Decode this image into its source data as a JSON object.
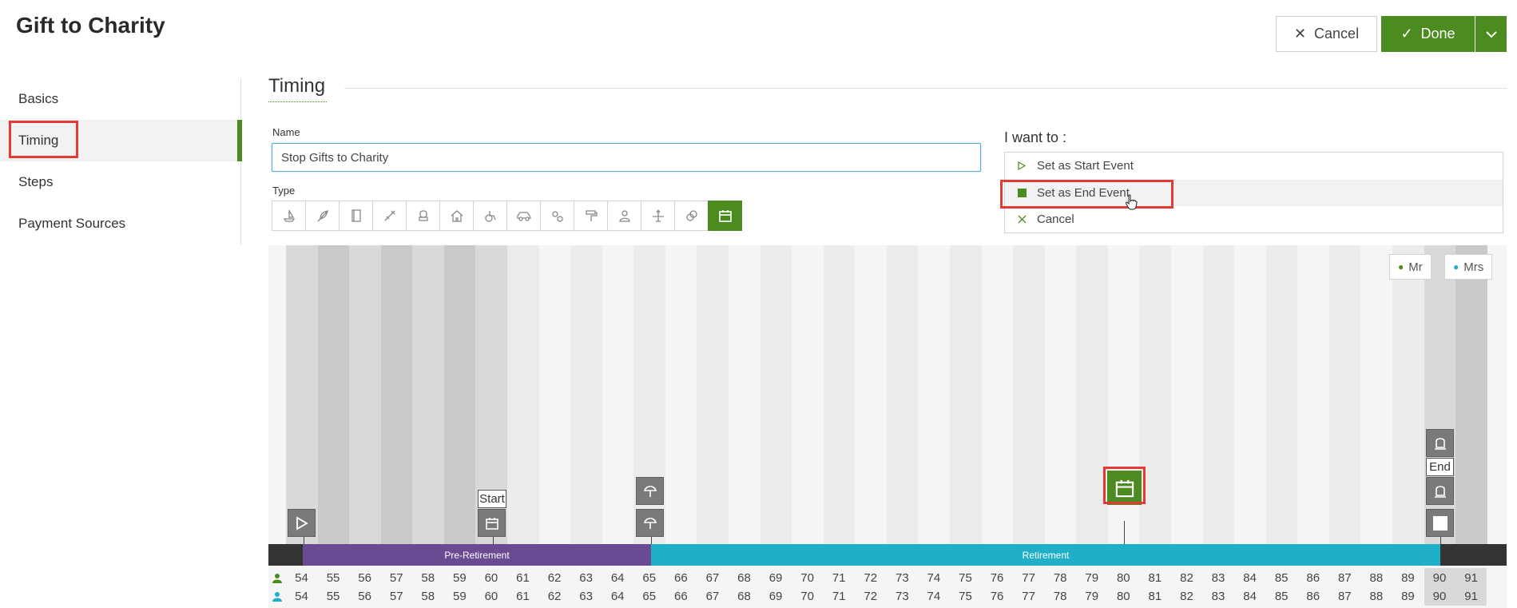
{
  "page": {
    "title": "Gift to Charity"
  },
  "actions": {
    "cancel_label": "Cancel",
    "done_label": "Done"
  },
  "sidebar": {
    "items": [
      {
        "label": "Basics"
      },
      {
        "label": "Timing"
      },
      {
        "label": "Steps"
      },
      {
        "label": "Payment Sources"
      }
    ]
  },
  "timing": {
    "section_title": "Timing",
    "name_label": "Name",
    "name_value": "Stop Gifts to Charity",
    "type_label": "Type",
    "type_icons": [
      "boat-icon",
      "feather-icon",
      "book-icon",
      "surgery-icon",
      "car-seat-icon",
      "home-icon",
      "wheelchair-icon",
      "car-icon",
      "bike-icon",
      "paint-roller-icon",
      "person-icon",
      "plane-icon",
      "rings-icon",
      "calendar-icon"
    ],
    "selected_type": "calendar-icon"
  },
  "want": {
    "label": "I want to :",
    "options": [
      {
        "label": "Set as Start Event",
        "icon": "play-outline-icon"
      },
      {
        "label": "Set as End Event",
        "icon": "stop-square-icon"
      },
      {
        "label": "Cancel",
        "icon": "close-icon"
      }
    ]
  },
  "timeline": {
    "legend": [
      {
        "label": "Mr",
        "color": "#4b8b1f"
      },
      {
        "label": "Mrs",
        "color": "#1fb0c8"
      }
    ],
    "phases": [
      {
        "label": "Pre-Retirement",
        "color": "#6b4a94"
      },
      {
        "label": "Retirement",
        "color": "#1fb0c8"
      }
    ],
    "start_label": "Start",
    "end_label": "End",
    "mr_ages": [
      "54",
      "55",
      "56",
      "57",
      "58",
      "59",
      "60",
      "61",
      "62",
      "63",
      "64",
      "65",
      "66",
      "67",
      "68",
      "69",
      "70",
      "71",
      "72",
      "73",
      "74",
      "75",
      "76",
      "77",
      "78",
      "79",
      "80",
      "81",
      "82",
      "83",
      "84",
      "85",
      "86",
      "87",
      "88",
      "89",
      "90",
      "91"
    ],
    "mrs_ages": [
      "54",
      "55",
      "56",
      "57",
      "58",
      "59",
      "60",
      "61",
      "62",
      "63",
      "64",
      "65",
      "66",
      "67",
      "68",
      "69",
      "70",
      "71",
      "72",
      "73",
      "74",
      "75",
      "76",
      "77",
      "78",
      "79",
      "80",
      "81",
      "82",
      "83",
      "84",
      "85",
      "86",
      "87",
      "88",
      "89",
      "90",
      "91"
    ]
  },
  "colors": {
    "accent": "#4b8b1f",
    "highlight": "#e53935",
    "retirement": "#1fb0c8",
    "pre_retirement": "#6b4a94"
  }
}
